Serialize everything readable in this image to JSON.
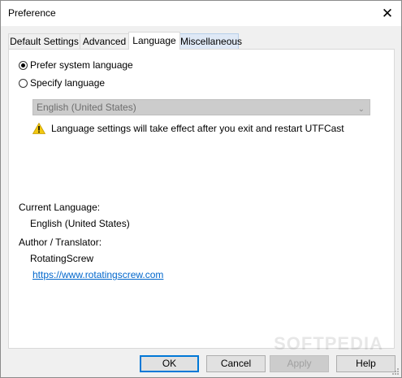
{
  "window": {
    "title": "Preference",
    "close_glyph": "✕"
  },
  "tabs": [
    {
      "label": "Default Settings"
    },
    {
      "label": "Advanced"
    },
    {
      "label": "Language"
    },
    {
      "label": "Miscellaneous"
    }
  ],
  "language": {
    "prefer_system_label": "Prefer system language",
    "specify_label": "Specify language",
    "selected_language": "English (United States)",
    "warning_text": "Language settings will take effect after you exit and restart UTFCast",
    "current_language_heading": "Current Language:",
    "current_language_value": "English (United States)",
    "author_heading": "Author / Translator:",
    "author_value": "RotatingScrew",
    "author_link": "https://www.rotatingscrew.com"
  },
  "buttons": {
    "ok": "OK",
    "cancel": "Cancel",
    "apply": "Apply",
    "help": "Help"
  },
  "watermark": "SOFTPEDIA",
  "colors": {
    "accent": "#0078d7",
    "link": "#0066cc",
    "warning": "#f2c811"
  }
}
